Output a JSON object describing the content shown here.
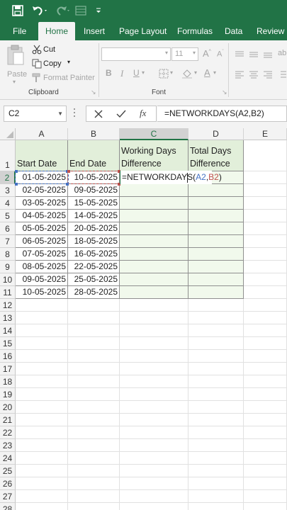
{
  "ribbon": {
    "tabs": [
      "File",
      "Home",
      "Insert",
      "Page Layout",
      "Formulas",
      "Data",
      "Review"
    ],
    "clipboard": {
      "paste": "Paste",
      "cut": "Cut",
      "copy": "Copy",
      "format_painter": "Format Painter",
      "group_label": "Clipboard"
    },
    "font": {
      "font_size": "11",
      "group_label": "Font",
      "bold": "B",
      "italic": "I",
      "underline": "U"
    }
  },
  "formula_bar": {
    "name_box": "C2",
    "formula": "=NETWORKDAYS(A2,B2)",
    "fx": "fx"
  },
  "columns": [
    "A",
    "B",
    "C",
    "D",
    "E"
  ],
  "rows": [
    "1",
    "2",
    "3",
    "4",
    "5",
    "6",
    "7",
    "8",
    "9",
    "10",
    "11",
    "12",
    "13",
    "14",
    "15",
    "16",
    "17",
    "18",
    "19",
    "20",
    "21",
    "22",
    "23",
    "24",
    "25",
    "26",
    "27",
    "28"
  ],
  "headers": {
    "a": "Start Date",
    "b": "End Date",
    "c_line1": "Working Days",
    "c_line2": "Difference",
    "d_line1": "Total Days",
    "d_line2": "Difference"
  },
  "table_rows": [
    {
      "start": "01-05-2025",
      "end": "10-05-2025"
    },
    {
      "start": "02-05-2025",
      "end": "09-05-2025"
    },
    {
      "start": "03-05-2025",
      "end": "15-05-2025"
    },
    {
      "start": "04-05-2025",
      "end": "14-05-2025"
    },
    {
      "start": "05-05-2025",
      "end": "20-05-2025"
    },
    {
      "start": "06-05-2025",
      "end": "18-05-2025"
    },
    {
      "start": "07-05-2025",
      "end": "16-05-2025"
    },
    {
      "start": "08-05-2025",
      "end": "22-05-2025"
    },
    {
      "start": "09-05-2025",
      "end": "25-05-2025"
    },
    {
      "start": "10-05-2025",
      "end": "28-05-2025"
    }
  ],
  "editing_cell": {
    "prefix": "=NETWORKDAYS(",
    "ref_a": "A2",
    "comma": ",",
    "ref_b": "B2",
    "suffix": ")"
  },
  "colors": {
    "brand": "#217346",
    "header_fill": "#e2efda",
    "body_fill": "#f1f9ec",
    "ref_a": "#4472c4",
    "ref_b": "#c0504d"
  }
}
